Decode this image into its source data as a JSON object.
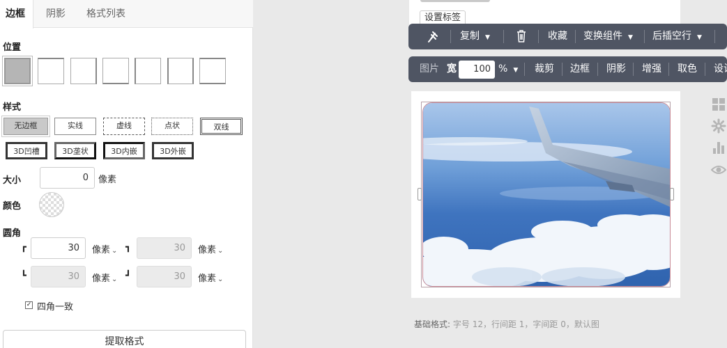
{
  "tabs": {
    "border": "边框",
    "shadow": "阴影",
    "format_list": "格式列表"
  },
  "sections": {
    "position": "位置",
    "style": "样式",
    "size": "大小",
    "color": "颜色",
    "radius": "圆角"
  },
  "style_options": {
    "none": "无边框",
    "solid": "实线",
    "dashed": "虚线",
    "dotted": "点状",
    "double": "双线",
    "groove": "3D凹槽",
    "ridge": "3D垄状",
    "inset": "3D内嵌",
    "outset": "3D外嵌"
  },
  "size": {
    "value": "0",
    "unit": "像素"
  },
  "radius": {
    "top_left": {
      "value": "30",
      "unit": "像素"
    },
    "top_right": {
      "value": "30",
      "unit": "像素"
    },
    "bottom_left": {
      "value": "30",
      "unit": "像素"
    },
    "bottom_right": {
      "value": "30",
      "unit": "像素"
    },
    "uniform_label": "四角一致",
    "uniform_checked": true
  },
  "extract_format": "提取格式",
  "canvas": {
    "tag_button": "设置标签",
    "toolbar1": {
      "copy": "复制",
      "collect": "收藏",
      "transform": "变换组件",
      "insert_after": "后插空行"
    },
    "toolbar2": {
      "image": "图片",
      "width_label": "宽",
      "width_value": "100",
      "width_unit": "%",
      "crop": "裁剪",
      "border": "边框",
      "shadow": "阴影",
      "enhance": "增强",
      "pick_color": "取色",
      "settings": "设计"
    },
    "footer_label": "基础格式:",
    "footer_value": "字号 12，行间距 1，字间距 0，默认图"
  },
  "colors": {
    "toolbar_bg": "#4f5563",
    "panel_bg": "#ffffff",
    "canvas_bg": "#e9e9e9",
    "accent_border": "#c98a96"
  }
}
